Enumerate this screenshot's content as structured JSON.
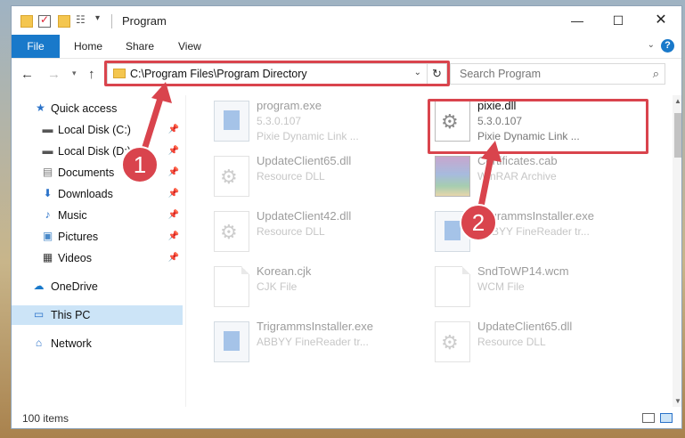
{
  "window": {
    "title": "Program",
    "min_label": "—",
    "max_label": "☐",
    "close_label": "✕"
  },
  "ribbon": {
    "file": "File",
    "home": "Home",
    "share": "Share",
    "view": "View",
    "help": "?"
  },
  "address": {
    "path": "C:\\Program Files\\Program Directory",
    "refresh_glyph": "↻"
  },
  "search": {
    "placeholder": "Search Program"
  },
  "sidebar": {
    "items": [
      {
        "label": "Quick access",
        "icon": "star-icon",
        "pinned": false
      },
      {
        "label": "Local Disk (C:)",
        "icon": "drive-icon",
        "pinned": true
      },
      {
        "label": "Local Disk (D:)",
        "icon": "drive-icon",
        "pinned": true
      },
      {
        "label": "Documents",
        "icon": "documents-icon",
        "pinned": true
      },
      {
        "label": "Downloads",
        "icon": "downloads-icon",
        "pinned": true
      },
      {
        "label": "Music",
        "icon": "music-icon",
        "pinned": true
      },
      {
        "label": "Pictures",
        "icon": "pictures-icon",
        "pinned": true
      },
      {
        "label": "Videos",
        "icon": "videos-icon",
        "pinned": true
      },
      {
        "label": "OneDrive",
        "icon": "cloud-icon",
        "pinned": false
      },
      {
        "label": "This PC",
        "icon": "computer-icon",
        "pinned": false,
        "selected": true
      },
      {
        "label": "Network",
        "icon": "network-icon",
        "pinned": false
      }
    ]
  },
  "files": [
    {
      "name": "program.exe",
      "version": "5.3.0.107",
      "desc": "Pixie Dynamic Link ...",
      "type": "exe"
    },
    {
      "name": "pixie.dll",
      "version": "5.3.0.107",
      "desc": "Pixie Dynamic Link ...",
      "type": "dll",
      "highlighted": true
    },
    {
      "name": "UpdateClient65.dll",
      "version": "Resource DLL",
      "desc": "",
      "type": "dll"
    },
    {
      "name": "Certificates.cab",
      "version": "WinRAR Archive",
      "desc": "",
      "type": "rar"
    },
    {
      "name": "UpdateClient42.dll",
      "version": "Resource DLL",
      "desc": "",
      "type": "dll"
    },
    {
      "name": "TrigrammsInstaller.exe",
      "version": "ABBYY FineReader tr...",
      "desc": "",
      "type": "exe"
    },
    {
      "name": "Korean.cjk",
      "version": "CJK File",
      "desc": "",
      "type": "doc"
    },
    {
      "name": "SndToWP14.wcm",
      "version": "WCM File",
      "desc": "",
      "type": "doc"
    },
    {
      "name": "TrigrammsInstaller.exe",
      "version": "ABBYY FineReader tr...",
      "desc": "",
      "type": "exe"
    },
    {
      "name": "UpdateClient65.dll",
      "version": "Resource DLL",
      "desc": "",
      "type": "dll"
    }
  ],
  "status": {
    "items": "100 items"
  },
  "callouts": {
    "one": "1",
    "two": "2"
  },
  "colors": {
    "accent": "#1979ca",
    "highlight": "#d9444d",
    "selected": "#cce4f7"
  }
}
